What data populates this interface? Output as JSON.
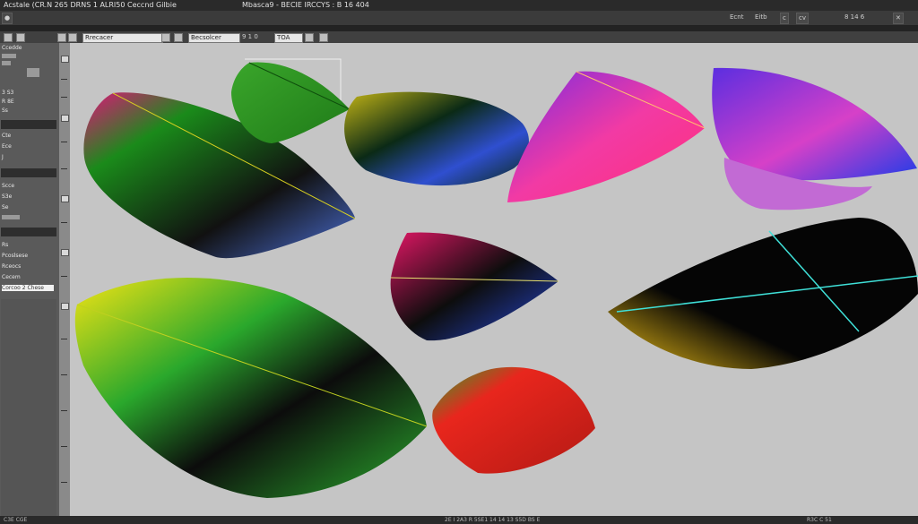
{
  "window": {
    "title": "Acstale (CR.N 265 DRNS 1 ALRI50 Ceccnd Gilbie",
    "info": "Mbasca9 - BECIE IRCCYS : B 16 404"
  },
  "options_bar": {
    "right_items": [
      "Ecnt",
      "Eitb",
      "c",
      "cv"
    ],
    "zoom": "8 14 6"
  },
  "toolbar": {
    "field1": "Rrecacer",
    "field2": "Becsolcer",
    "zoom_value": "9 1 0",
    "mode": "TOA"
  },
  "left_panel": {
    "header": "Ccedde",
    "labels": [
      "3 S3",
      "R 8E",
      "Ss",
      "Cte",
      "Ece",
      "J",
      "Scce",
      "S3e",
      "Se",
      "Rs",
      "Pcoslsese",
      "Rceocs",
      "Cecem"
    ],
    "list_item": "Corcoo 2 Chese"
  },
  "status": {
    "left": "C3E CGE",
    "middle": "2E I 2A3 R 5SE1 14 14 13 S5D BS E",
    "right": "R3C   C  51"
  },
  "canvas": {
    "shapes": [
      {
        "name": "dark-green-leaf",
        "colors": [
          "#e0147a",
          "#1a8a1a",
          "#111111",
          "#4b6fd6"
        ]
      },
      {
        "name": "small-green-leaf",
        "colors": [
          "#3aa62b",
          "#1f7a18"
        ]
      },
      {
        "name": "dark-rainbow-leaf",
        "colors": [
          "#0b2a16",
          "#2f4fd0",
          "#c4b516"
        ]
      },
      {
        "name": "pink-purple-leaf",
        "colors": [
          "#f23aa4",
          "#7a2ce0",
          "#ff2f7a"
        ]
      },
      {
        "name": "blue-purple-leaf",
        "colors": [
          "#5b2ee0",
          "#d640c8",
          "#1e3ce8"
        ]
      },
      {
        "name": "small-magenta-leaf",
        "colors": [
          "#e01664",
          "#2647d6",
          "#0d0d0d"
        ]
      },
      {
        "name": "black-yellow-leaf",
        "colors": [
          "#050505",
          "#f3c316",
          "#3fe0d8"
        ]
      },
      {
        "name": "yellow-green-leaf",
        "colors": [
          "#f4e414",
          "#2aa82c",
          "#0c0c0c"
        ]
      },
      {
        "name": "red-orange-leaf",
        "colors": [
          "#e8261d",
          "#2fa52a"
        ]
      }
    ]
  }
}
